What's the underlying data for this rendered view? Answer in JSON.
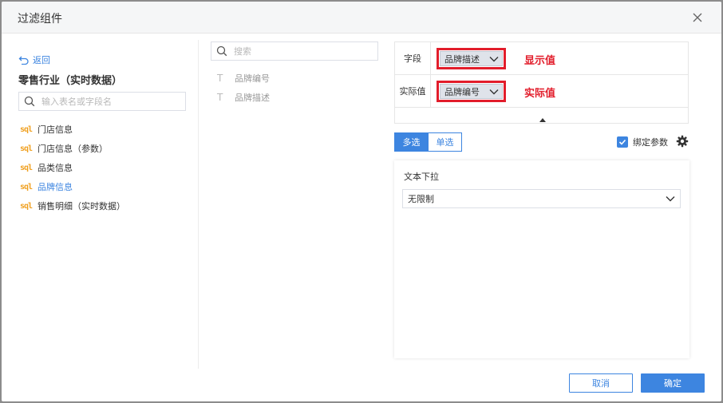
{
  "dialog": {
    "title": "过滤组件",
    "cancel_label": "取消",
    "ok_label": "确定"
  },
  "left": {
    "back_label": "返回",
    "package_title": "零售行业（实时数据）",
    "search_placeholder": "输入表名或字段名",
    "tables": [
      {
        "label": "门店信息",
        "icon": "sql-icon",
        "active": false
      },
      {
        "label": "门店信息（参数）",
        "icon": "sql-icon",
        "active": false
      },
      {
        "label": "品类信息",
        "icon": "sql-icon",
        "active": false
      },
      {
        "label": "品牌信息",
        "icon": "sql-icon",
        "active": true
      },
      {
        "label": "销售明细（实时数据）",
        "icon": "sql-icon",
        "active": false
      }
    ]
  },
  "middle": {
    "search_placeholder": "搜索",
    "fields": [
      {
        "label": "品牌编号",
        "icon": "text-type-icon"
      },
      {
        "label": "品牌描述",
        "icon": "text-type-icon"
      }
    ]
  },
  "mapping": {
    "rows": [
      {
        "label": "字段",
        "value": "品牌描述",
        "note": "显示值"
      },
      {
        "label": "实际值",
        "value": "品牌编号",
        "note": "实际值"
      }
    ]
  },
  "mode": {
    "multi_label": "多选",
    "single_label": "单选",
    "selected": "多选"
  },
  "bind_param": {
    "label": "绑定参数",
    "checked": true
  },
  "preview": {
    "label": "文本下拉",
    "select_value": "无限制"
  },
  "colors": {
    "accent": "#3d85e0",
    "highlight_red": "#e21d2b",
    "sql_orange": "#f0a020"
  }
}
